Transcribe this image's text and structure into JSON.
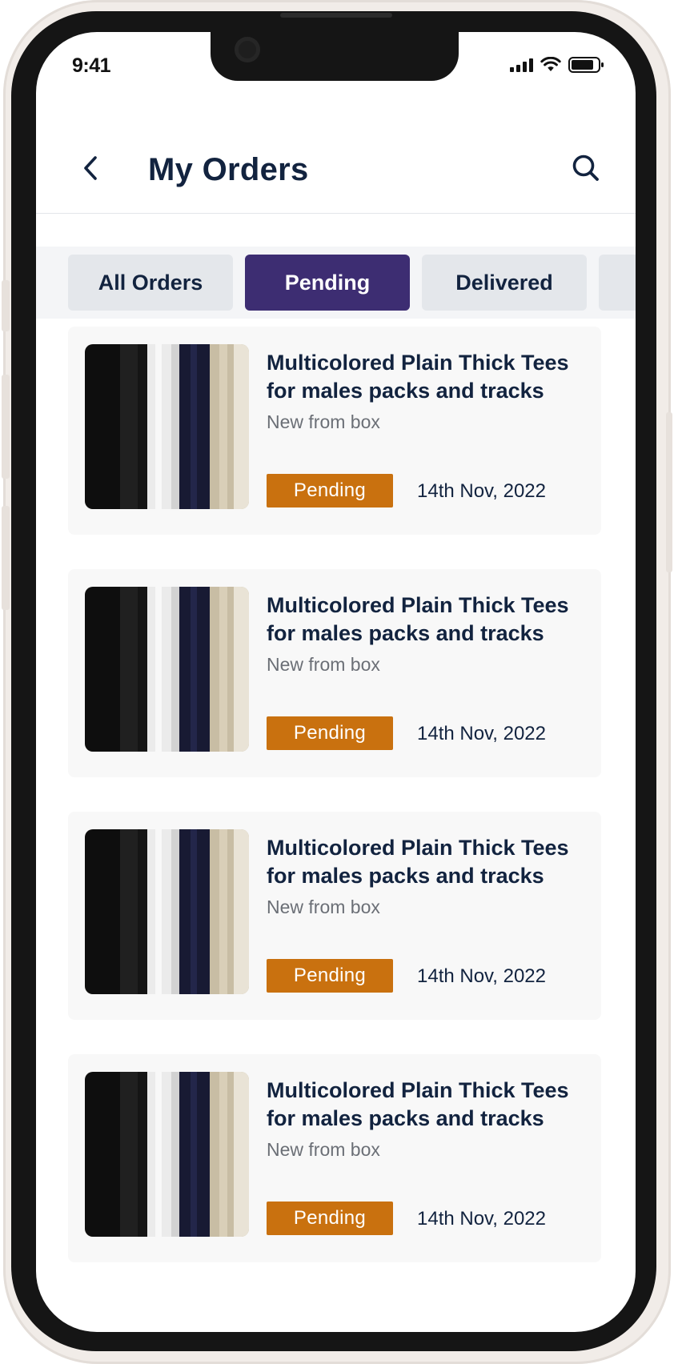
{
  "status_bar": {
    "time": "9:41"
  },
  "header": {
    "title": "My Orders"
  },
  "tabs": [
    {
      "label": "All Orders",
      "active": false
    },
    {
      "label": "Pending",
      "active": true
    },
    {
      "label": "Delivered",
      "active": false
    },
    {
      "label": "",
      "active": false
    }
  ],
  "orders": [
    {
      "title": "Multicolored Plain Thick Tees for males packs and tracks",
      "subtitle": "New from box",
      "status": "Pending",
      "date": "14th Nov, 2022"
    },
    {
      "title": "Multicolored Plain Thick Tees for males packs and tracks",
      "subtitle": "New from box",
      "status": "Pending",
      "date": "14th Nov, 2022"
    },
    {
      "title": "Multicolored Plain Thick Tees for males packs and tracks",
      "subtitle": "New from box",
      "status": "Pending",
      "date": "14th Nov, 2022"
    },
    {
      "title": "Multicolored Plain Thick Tees for males packs and tracks",
      "subtitle": "New from box",
      "status": "Pending",
      "date": "14th Nov, 2022"
    }
  ],
  "colors": {
    "primary": "#3d2d72",
    "pending_badge": "#c9710f",
    "text_dark": "#12233f",
    "text_muted": "#6b6f76",
    "tab_inactive": "#e4e7eb",
    "card_background": "#f8f8f8"
  },
  "icons": {
    "back": "chevron-left-icon",
    "search": "search-icon",
    "signal": "cellular-signal-icon",
    "wifi": "wifi-icon",
    "battery": "battery-icon"
  }
}
